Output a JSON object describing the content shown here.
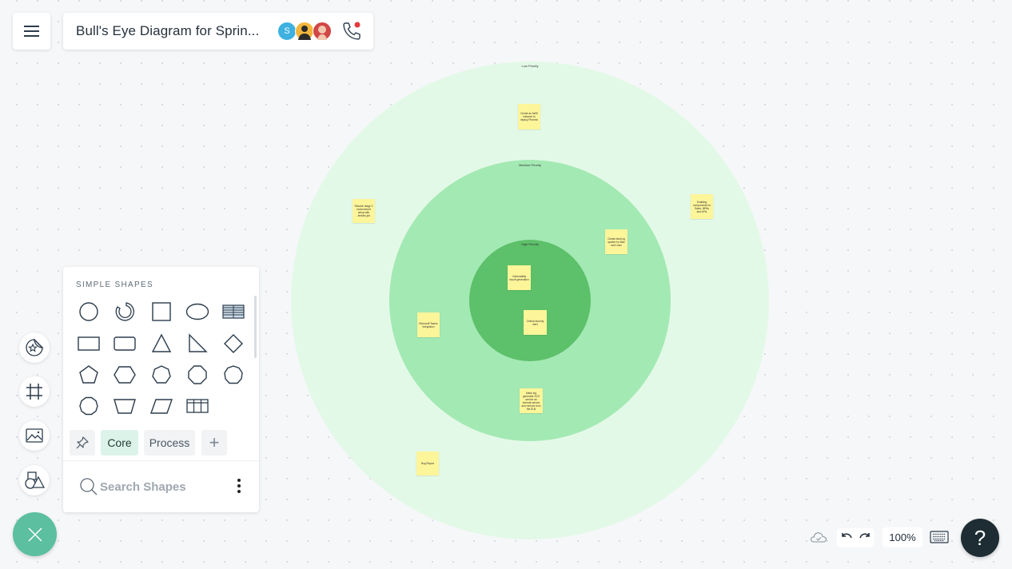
{
  "header": {
    "document_title": "Bull's Eye Diagram for Sprin...",
    "collaborators": [
      {
        "initial": "S",
        "color": "#3db1e0"
      },
      {
        "initial": "",
        "color": "#f3b63c"
      },
      {
        "initial": "",
        "color": "#d24646"
      }
    ],
    "call_indicator_color": "#e53b3b"
  },
  "diagram": {
    "rings": [
      {
        "label": "Low Priority",
        "color": "#e3f9e7"
      },
      {
        "label": "Medium Priority",
        "color": "#a3e9b3"
      },
      {
        "label": "High Priority",
        "color": "#5dc06a"
      }
    ],
    "sticky_color": "#fdf59a",
    "stickies": [
      {
        "text": "Create an AWS instance to deploy Phoenix",
        "ring": "Low Priority"
      },
      {
        "text": "Resolve stage 2 environment setup with Jenkins job",
        "ring": "Low Priority"
      },
      {
        "text": "Enabling components for Sales, MPAs and APIs",
        "ring": "Low Priority"
      },
      {
        "text": "Create deal log system for Mac and Linux",
        "ring": "Medium Priority"
      },
      {
        "text": "Vulnerability report generation",
        "ring": "High Priority"
      },
      {
        "text": "Critical security alert",
        "ring": "High Priority"
      },
      {
        "text": "Microsoft Teams Integration",
        "ring": "Medium Priority"
      },
      {
        "text": "Make log generator SCS service an internal service and remove from the ELB",
        "ring": "Medium Priority"
      },
      {
        "text": "Bug Report",
        "ring": "Low Priority"
      }
    ]
  },
  "left_toolbar": {
    "items": [
      {
        "name": "stickers-icon"
      },
      {
        "name": "frame-icon"
      },
      {
        "name": "image-icon"
      },
      {
        "name": "shapes-icon"
      }
    ],
    "close_color": "#5bbfa0"
  },
  "shapes_panel": {
    "heading": "SIMPLE SHAPES",
    "shapes": [
      "circle",
      "ring",
      "square",
      "ellipse",
      "table-striped",
      "rectangle",
      "rounded-rectangle",
      "triangle",
      "right-triangle",
      "diamond",
      "pentagon",
      "hexagon",
      "heptagon",
      "octagon",
      "nonagon",
      "decagon",
      "trapezoid",
      "parallelogram",
      "table-grid"
    ],
    "tabs": [
      {
        "label": "Core",
        "active": true
      },
      {
        "label": "Process",
        "active": false
      }
    ],
    "add_tab_label": "+",
    "search_placeholder": "Search Shapes",
    "search_value": ""
  },
  "bottom_bar": {
    "zoom_level": "100%",
    "help_label": "?"
  }
}
